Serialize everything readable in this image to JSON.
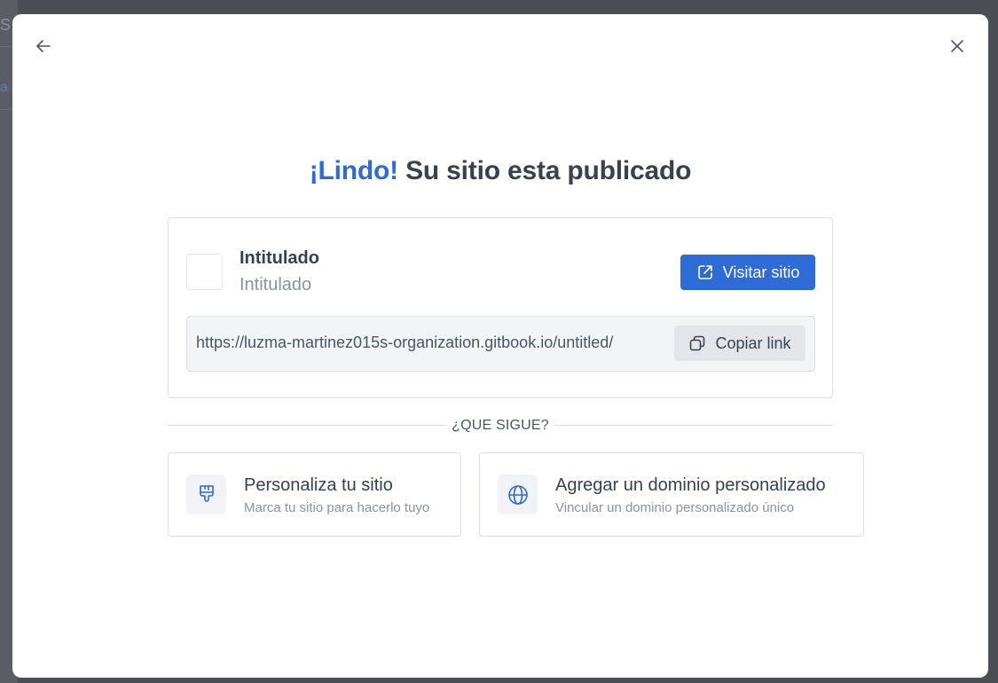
{
  "background": {
    "tab_fragment": "S",
    "link_fragment": "a"
  },
  "modal": {
    "title_accent": "¡Lindo!",
    "title_rest": " Su sitio esta publicado",
    "site": {
      "name": "Intitulado",
      "subtitle": "Intitulado",
      "visit_label": "Visitar sitio",
      "url": "https://luzma-martinez015s-organization.gitbook.io/untitled/",
      "copy_label": "Copiar link"
    },
    "next_heading": "¿QUE SIGUE?",
    "next_steps": [
      {
        "title": "Personaliza tu sitio",
        "subtitle": "Marca tu sitio para hacerlo tuyo",
        "icon": "paintbrush-icon"
      },
      {
        "title": "Agregar un dominio personalizado",
        "subtitle": "Vincular un dominio personalizado único",
        "icon": "globe-icon"
      }
    ]
  },
  "colors": {
    "accent": "#2f6bd6",
    "overlay": "#4b4f55",
    "text": "#374151",
    "muted": "#8d939c"
  }
}
